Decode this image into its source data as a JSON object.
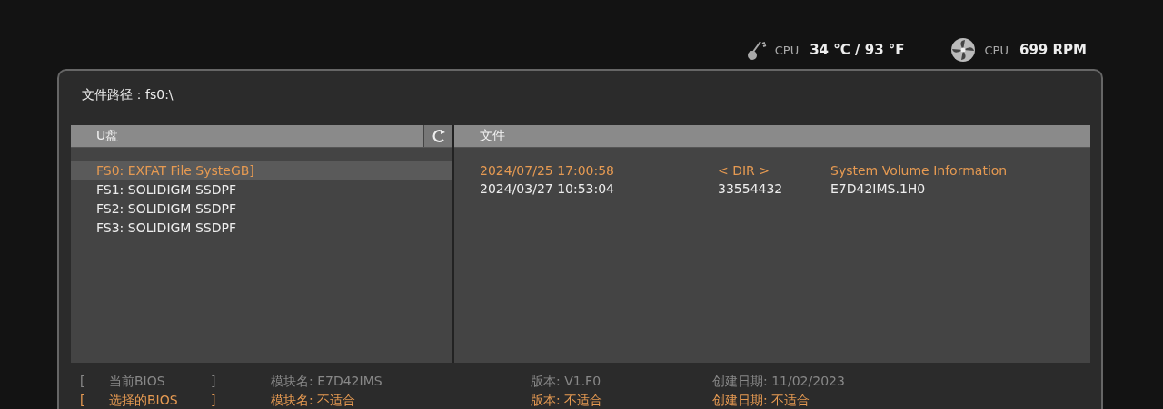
{
  "status": [
    {
      "kind": "temp",
      "label": "CPU",
      "value": "34 °C / 93 °F"
    },
    {
      "kind": "fan",
      "label": "CPU",
      "value": "699 RPM"
    }
  ],
  "path": {
    "label": "文件路径：",
    "value": "fs0:\\"
  },
  "drives": {
    "header": "U盘",
    "items": [
      {
        "label": "FS0: EXFAT File SysteGB]",
        "selected": true
      },
      {
        "label": "FS1: SOLIDIGM SSDPF",
        "selected": false
      },
      {
        "label": "FS2: SOLIDIGM SSDPF",
        "selected": false
      },
      {
        "label": "FS3: SOLIDIGM SSDPF",
        "selected": false
      }
    ]
  },
  "files": {
    "header": "文件",
    "rows": [
      {
        "date": "2024/07/25 17:00:58",
        "size": "< DIR >",
        "name": "System Volume Information",
        "selected": true
      },
      {
        "date": "2024/03/27 10:53:04",
        "size": "33554432",
        "name": "E7D42IMS.1H0",
        "selected": false
      }
    ]
  },
  "bios": [
    {
      "open": "[",
      "label": "当前BIOS",
      "close": "]",
      "module": "模块名: E7D42IMS",
      "version": "版本: V1.F0",
      "date": "创建日期: 11/02/2023",
      "selected": false
    },
    {
      "open": "[",
      "label": "选择的BIOS",
      "close": "]",
      "module": "模块名: 不适合",
      "version": "版本: 不适合",
      "date": "创建日期: 不适合",
      "selected": true
    }
  ]
}
